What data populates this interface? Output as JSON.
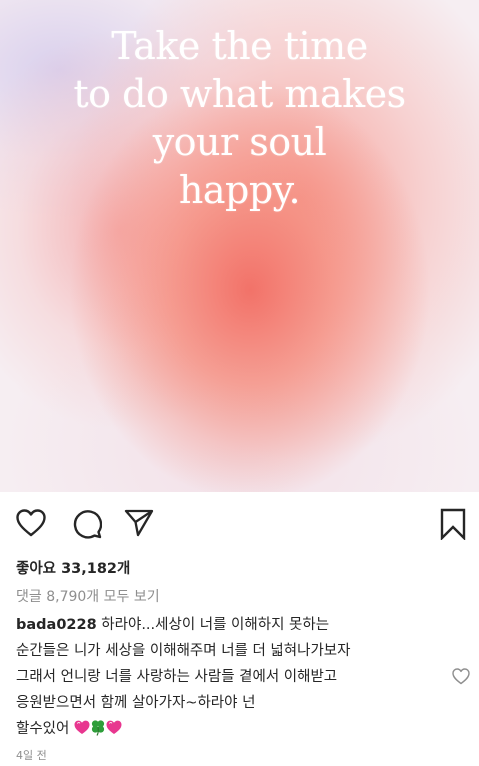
{
  "post": {
    "image_quote": [
      "Take the time",
      "to do what makes",
      "your soul",
      "happy."
    ]
  },
  "actions": {
    "like_icon": "heart-outline-icon",
    "comment_icon": "comment-bubble-icon",
    "share_icon": "paper-plane-icon",
    "save_icon": "bookmark-outline-icon"
  },
  "likes_text": "좋아요 33,182개",
  "comments_link": "댓글 8,790개 모두 보기",
  "caption": {
    "username": "bada0228",
    "line1_text": " 하라야...세상이 너를 이해하지 못하는",
    "line2": "순간들은 니가 세상을 이해해주며 너를 더 넓혀나가보자",
    "line3": "그래서 언니랑 너를 사랑하는 사람들 곁에서 이해받고",
    "line4": "응원받으면서 함께 살아가자~하라야 넌",
    "line5": "할수있어",
    "emojis": [
      "pink-heart",
      "four-leaf-clover",
      "pink-heart"
    ]
  },
  "timestamp": "4일 전",
  "colors": {
    "text": "#262626",
    "secondary": "#8e8e8e",
    "emoji_heart": "#e8368f",
    "emoji_clover": "#2e9e3a"
  }
}
